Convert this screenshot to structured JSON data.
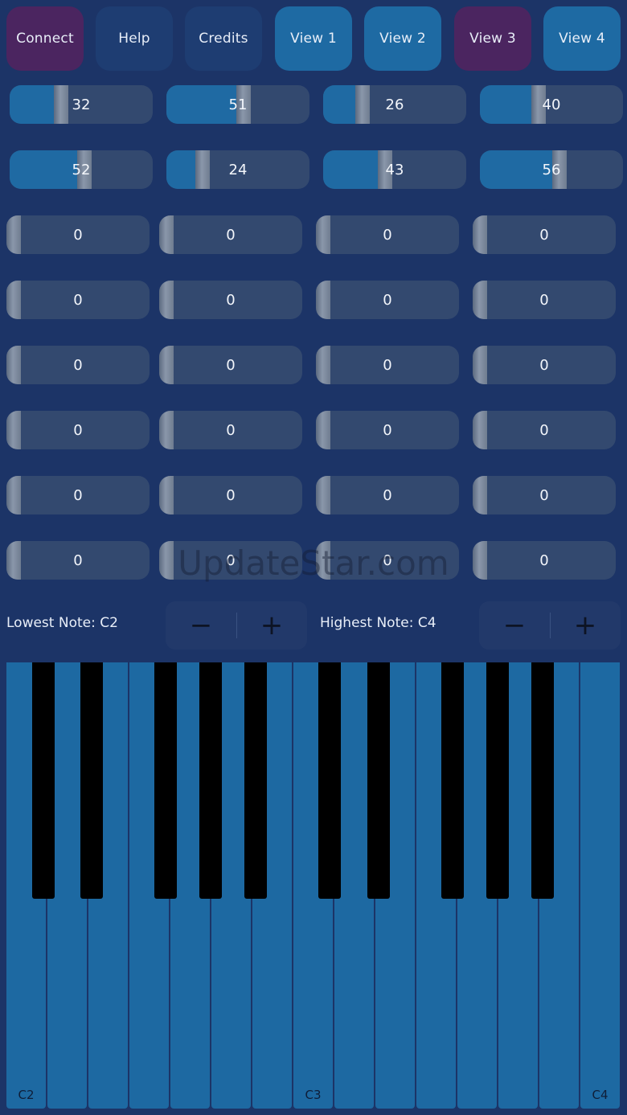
{
  "toolbar": {
    "connect": "Connect",
    "help": "Help",
    "credits": "Credits",
    "view1": "View 1",
    "view2": "View 2",
    "view3": "View 3",
    "view4": "View 4"
  },
  "sliders": [
    [
      "32",
      "51",
      "26",
      "40"
    ],
    [
      "52",
      "24",
      "43",
      "56"
    ],
    [
      "0",
      "0",
      "0",
      "0"
    ],
    [
      "0",
      "0",
      "0",
      "0"
    ],
    [
      "0",
      "0",
      "0",
      "0"
    ],
    [
      "0",
      "0",
      "0",
      "0"
    ],
    [
      "0",
      "0",
      "0",
      "0"
    ],
    [
      "0",
      "0",
      "0",
      "0"
    ]
  ],
  "watermark": "UpdateStar.com",
  "notes": {
    "lowest_label": "Lowest Note: C2",
    "highest_label": "Highest Note: C4",
    "minus": "−",
    "plus": "+"
  },
  "piano": {
    "labels": {
      "c2": "C2",
      "c3": "C3",
      "c4": "C4"
    }
  },
  "colors": {
    "background": "#1c3467",
    "accent": "#1f6aa3",
    "purple": "#4b2560"
  }
}
